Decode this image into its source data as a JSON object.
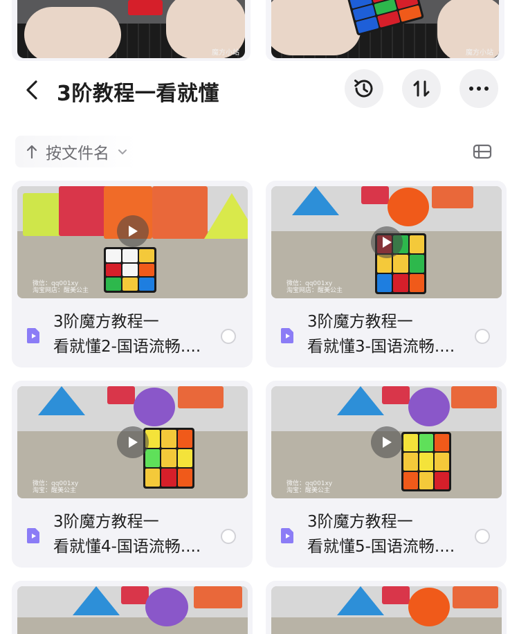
{
  "top_cards": [
    {
      "watermark": "魔方小站"
    },
    {
      "watermark": "魔方小站"
    }
  ],
  "header": {
    "title": "3阶教程一看就懂"
  },
  "sort": {
    "label": "按文件名"
  },
  "items": [
    {
      "name_line1": "3阶魔方教程一",
      "name_line2": "看就懂2-国语流畅....",
      "wm1": "微信：qq001xy",
      "wm2": "淘宝网店：醒美公主"
    },
    {
      "name_line1": "3阶魔方教程一",
      "name_line2": "看就懂3-国语流畅....",
      "wm1": "微信：qq001xy",
      "wm2": "淘宝网店：醒美公主"
    },
    {
      "name_line1": "3阶魔方教程一",
      "name_line2": "看就懂4-国语流畅....",
      "wm1": "微信：qq001xy",
      "wm2": "淘宝：醒美公主"
    },
    {
      "name_line1": "3阶魔方教程一",
      "name_line2": "看就懂5-国语流畅....",
      "wm1": "微信：qq001xy",
      "wm2": "淘宝：醒美公主"
    }
  ],
  "icons": {
    "back": "chevron-left-icon",
    "history": "history-icon",
    "sort": "sort-icon",
    "more": "more-icon",
    "sort_direction": "arrow-up-icon",
    "sort_menu": "chevron-down-icon",
    "view_toggle": "list-view-icon",
    "file": "video-file-icon",
    "play": "play-icon"
  },
  "colors": {
    "card_bg": "#f3f3f7",
    "accent_file": "#8b7cf6",
    "title": "#1e1e1e",
    "muted": "#6e6e73"
  }
}
